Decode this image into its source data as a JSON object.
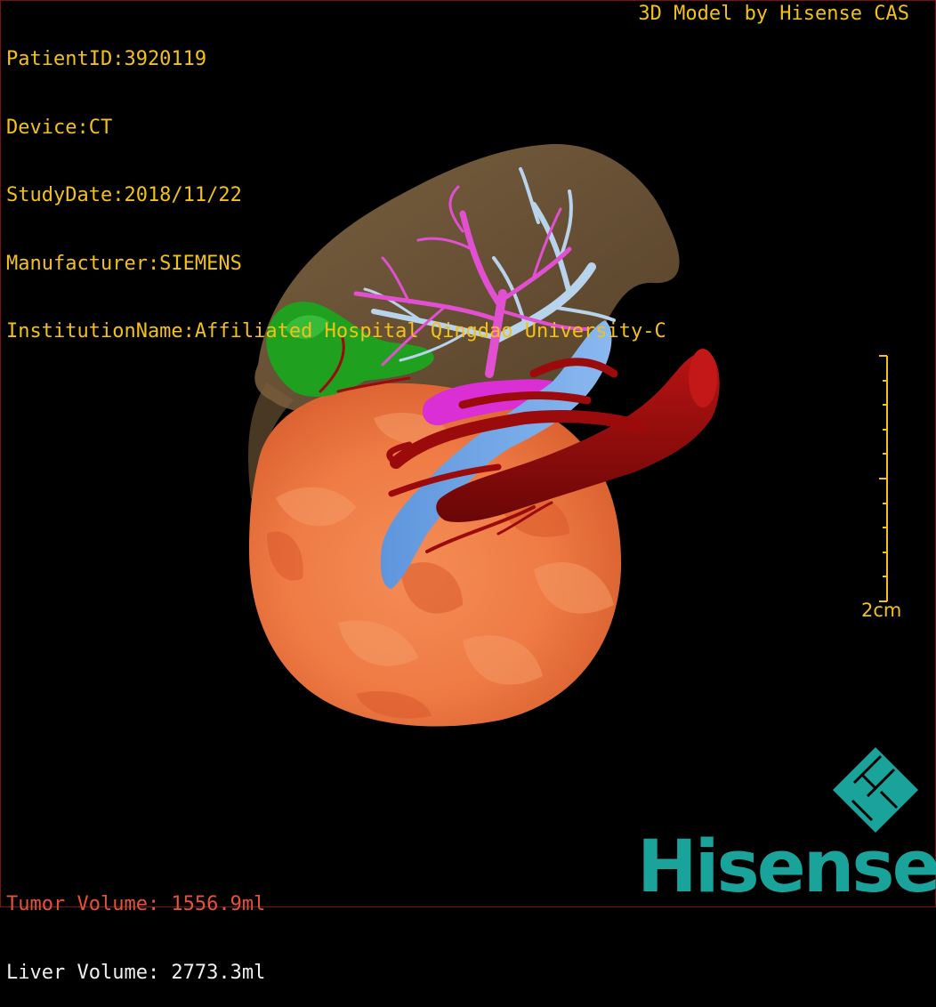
{
  "header": {
    "patient_id": "PatientID:3920119",
    "device": "Device:CT",
    "study_date": "StudyDate:2018/11/22",
    "manufacturer": "Manufacturer:SIEMENS",
    "institution": "InstitutionName:Affiliated Hospital Qingdao University-C",
    "brand_caption": "3D Model by Hisense CAS"
  },
  "footer": {
    "tumor_volume": "Tumor Volume: 1556.9ml",
    "liver_volume": "Liver Volume: 2773.3ml"
  },
  "scale_bar": {
    "label": "2cm"
  },
  "logo": {
    "wordmark": "Hisense"
  },
  "colors": {
    "overlay_text": "#f2c11a",
    "tumor_text": "#e8503c",
    "liver": "#8a6a42",
    "tumor": "#f0703a",
    "gallbladder": "#1fa01f",
    "hepatic_vein": "#b8d4ec",
    "portal_vein": "#e050d0",
    "vena_cava": "#6fa8e8",
    "artery": "#9c0b0b",
    "brand": "#1aa39b"
  }
}
